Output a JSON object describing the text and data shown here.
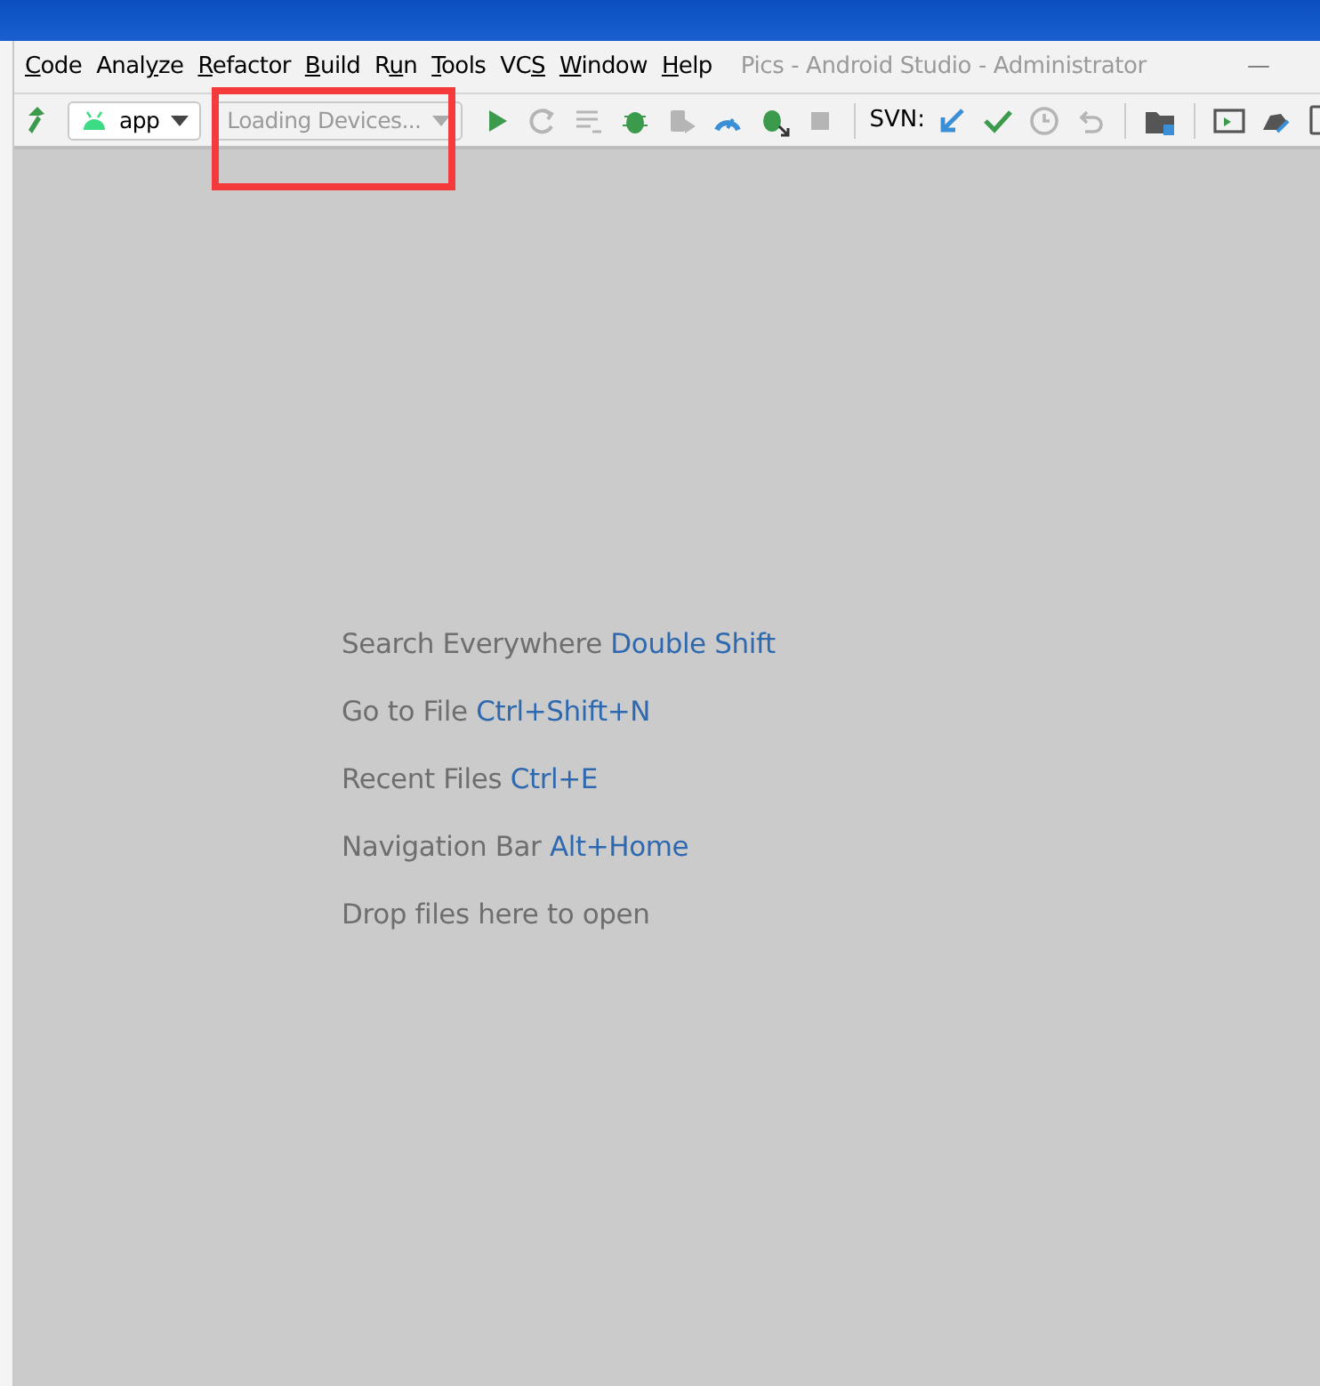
{
  "window": {
    "title": "Pics - Android Studio - Administrator",
    "minimize": "—"
  },
  "menu": [
    {
      "key": "C",
      "post": "ode"
    },
    {
      "pre": "Anal",
      "key": "y",
      "post": "ze"
    },
    {
      "key": "R",
      "post": "efactor"
    },
    {
      "key": "B",
      "post": "uild"
    },
    {
      "pre": "R",
      "key": "u",
      "post": "n"
    },
    {
      "key": "T",
      "post": "ools"
    },
    {
      "pre": "VC",
      "key": "S"
    },
    {
      "key": "W",
      "post": "indow"
    },
    {
      "key": "H",
      "post": "elp"
    }
  ],
  "toolbar": {
    "config": "app",
    "device": {
      "label": "Loading Devices...",
      "disabled": true
    },
    "run_tools": [
      {
        "kind": "run",
        "disabled": false
      },
      {
        "kind": "rerun",
        "disabled": true
      },
      {
        "kind": "coverage",
        "disabled": true
      },
      {
        "kind": "debug",
        "disabled": false
      },
      {
        "kind": "apply",
        "disabled": true
      },
      {
        "kind": "profile",
        "disabled": false
      },
      {
        "kind": "attach",
        "disabled": false
      },
      {
        "kind": "stop",
        "disabled": true
      }
    ],
    "svn_label": "SVN:",
    "svn_tools": [
      {
        "kind": "update",
        "disabled": false
      },
      {
        "kind": "commit",
        "disabled": false
      },
      {
        "kind": "history",
        "disabled": true
      },
      {
        "kind": "revert",
        "disabled": true
      }
    ]
  },
  "hints": [
    {
      "text": "Search Everywhere",
      "shortcut": "Double Shift"
    },
    {
      "text": "Go to File",
      "shortcut": "Ctrl+Shift+N"
    },
    {
      "text": "Recent Files",
      "shortcut": "Ctrl+E"
    },
    {
      "text": "Navigation Bar",
      "shortcut": "Alt+Home"
    },
    {
      "text": "Drop files here to open"
    }
  ]
}
